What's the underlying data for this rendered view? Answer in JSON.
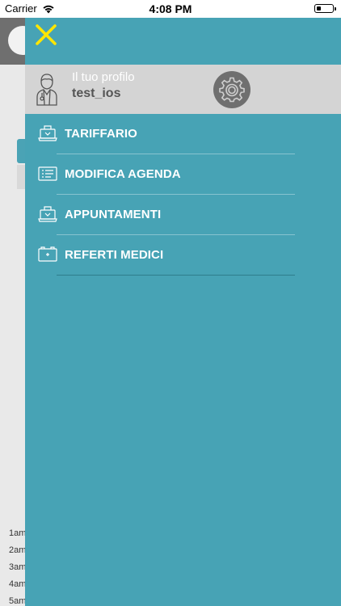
{
  "status_bar": {
    "carrier": "Carrier",
    "time": "4:08 PM"
  },
  "background_app": {
    "hours": [
      "1am",
      "2am",
      "3am",
      "4am",
      "5am"
    ]
  },
  "drawer": {
    "profile": {
      "caption": "Il tuo profilo",
      "username": "test_ios"
    },
    "menu": [
      {
        "label": "TARIFFARIO",
        "icon": "laptop-icon"
      },
      {
        "label": "MODIFICA AGENDA",
        "icon": "agenda-list-icon"
      },
      {
        "label": "APPUNTAMENTI",
        "icon": "laptop-icon"
      },
      {
        "label": "REFERTI MEDICI",
        "icon": "medical-report-icon"
      }
    ]
  },
  "colors": {
    "drawer_background": "#47a3b5",
    "close_icon": "#ffe600",
    "profile_background": "#d4d4d4",
    "settings_button": "#6f6f6f"
  }
}
